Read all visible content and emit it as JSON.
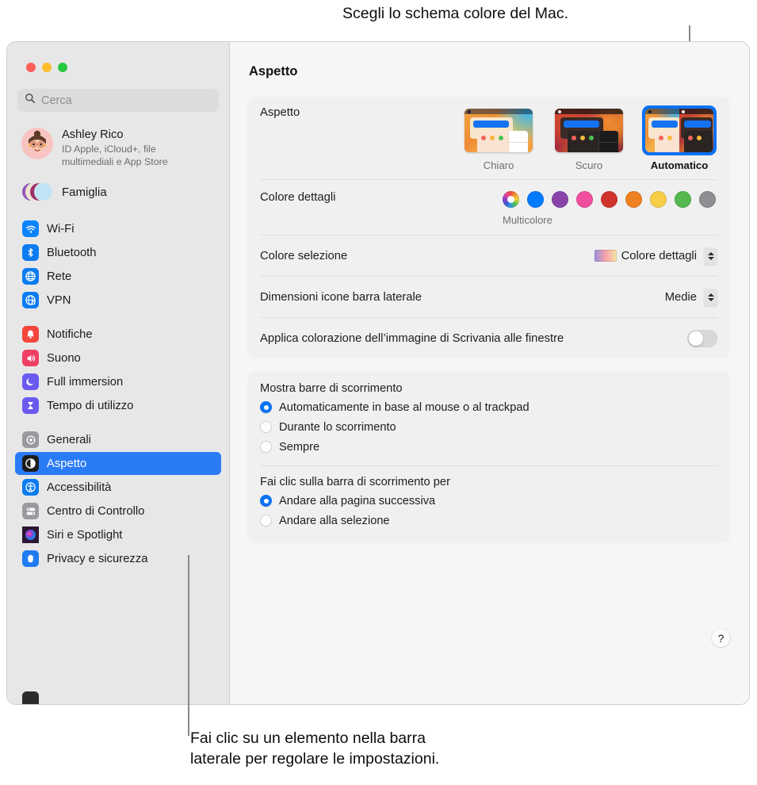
{
  "callouts": {
    "top": "Scegli lo schema colore del Mac.",
    "bottom_line1": "Fai clic su un elemento nella barra",
    "bottom_line2": "laterale per regolare le impostazioni."
  },
  "window": {
    "traffic_lights": [
      "close",
      "minimize",
      "zoom"
    ]
  },
  "search": {
    "placeholder": "Cerca",
    "value": ""
  },
  "account": {
    "name": "Ashley Rico",
    "subtitle": "ID Apple, iCloud+, file multimediali e App Store",
    "family_label": "Famiglia"
  },
  "sidebar": {
    "groups": [
      {
        "items": [
          {
            "label": "Wi-Fi",
            "icon": "wifi-icon",
            "color": "#0a84ff"
          },
          {
            "label": "Bluetooth",
            "icon": "bluetooth-icon",
            "color": "#0a7cf0"
          },
          {
            "label": "Rete",
            "icon": "network-globe-icon",
            "color": "#0a7cf0"
          },
          {
            "label": "VPN",
            "icon": "vpn-globe-icon",
            "color": "#0a7cf0"
          }
        ]
      },
      {
        "items": [
          {
            "label": "Notifiche",
            "icon": "bell-icon",
            "color": "#f4453c"
          },
          {
            "label": "Suono",
            "icon": "speaker-icon",
            "color": "#f03f63"
          },
          {
            "label": "Full immersion",
            "icon": "moon-icon",
            "color": "#6a5af0"
          },
          {
            "label": "Tempo di utilizzo",
            "icon": "hourglass-icon",
            "color": "#6a5af0"
          }
        ]
      },
      {
        "items": [
          {
            "label": "Generali",
            "icon": "gear-icon",
            "color": "#8e8e93",
            "selected": false
          },
          {
            "label": "Aspetto",
            "icon": "appearance-icon",
            "color": "#1c1c1e",
            "selected": true
          },
          {
            "label": "Accessibilità",
            "icon": "accessibility-icon",
            "color": "#0a7cf0",
            "selected": false
          },
          {
            "label": "Centro di Controllo",
            "icon": "control-center-icon",
            "color": "#8e8e93",
            "selected": false
          },
          {
            "label": "Siri e Spotlight",
            "icon": "siri-icon",
            "color": "#3a1f4f",
            "selected": false
          },
          {
            "label": "Privacy e sicurezza",
            "icon": "hand-privacy-icon",
            "color": "#1f7cf2",
            "selected": false
          }
        ]
      }
    ]
  },
  "main": {
    "page_title": "Aspetto",
    "appearance": {
      "label": "Aspetto",
      "options": [
        {
          "label": "Chiaro",
          "value": "light",
          "selected": false
        },
        {
          "label": "Scuro",
          "value": "dark",
          "selected": false
        },
        {
          "label": "Automatico",
          "value": "auto",
          "selected": true
        }
      ]
    },
    "accent": {
      "label": "Colore dettagli",
      "selected_name": "Multicolore",
      "swatches": [
        {
          "name": "multicolore",
          "color": "multicolor",
          "selected": true
        },
        {
          "name": "blu",
          "color": "#007aff"
        },
        {
          "name": "viola",
          "color": "#8944ab"
        },
        {
          "name": "rosa",
          "color": "#f martin"
        },
        {
          "name": "rosso",
          "color": "#d0342c"
        },
        {
          "name": "arancione",
          "color": "#ef8120"
        },
        {
          "name": "giallo",
          "color": "#f7ce46"
        },
        {
          "name": "verde",
          "color": "#54b84f"
        },
        {
          "name": "grigio",
          "color": "#8e8e93"
        }
      ]
    },
    "highlight": {
      "label": "Colore selezione",
      "value": "Colore dettagli"
    },
    "sidebar_icon_size": {
      "label": "Dimensioni icone barra laterale",
      "value": "Medie"
    },
    "wallpaper_tinting": {
      "label": "Applica colorazione dell’immagine di Scrivania alle finestre",
      "enabled": false
    },
    "scrollbars": {
      "title": "Mostra barre di scorrimento",
      "options": [
        {
          "label": "Automaticamente in base al mouse o al trackpad",
          "selected": true
        },
        {
          "label": "Durante lo scorrimento",
          "selected": false
        },
        {
          "label": "Sempre",
          "selected": false
        }
      ]
    },
    "scrollbar_click": {
      "title": "Fai clic sulla barra di scorrimento per",
      "options": [
        {
          "label": "Andare alla pagina successiva",
          "selected": true
        },
        {
          "label": "Andare alla selezione",
          "selected": false
        }
      ]
    },
    "help_button": "?"
  },
  "colors": {
    "accent_blue": "#2a7bf6",
    "selection_ring": "#0a71f2",
    "sidebar_bg": "#e7e7e7",
    "content_bg": "#f6f6f6",
    "card_bg": "#f0f0f0"
  }
}
